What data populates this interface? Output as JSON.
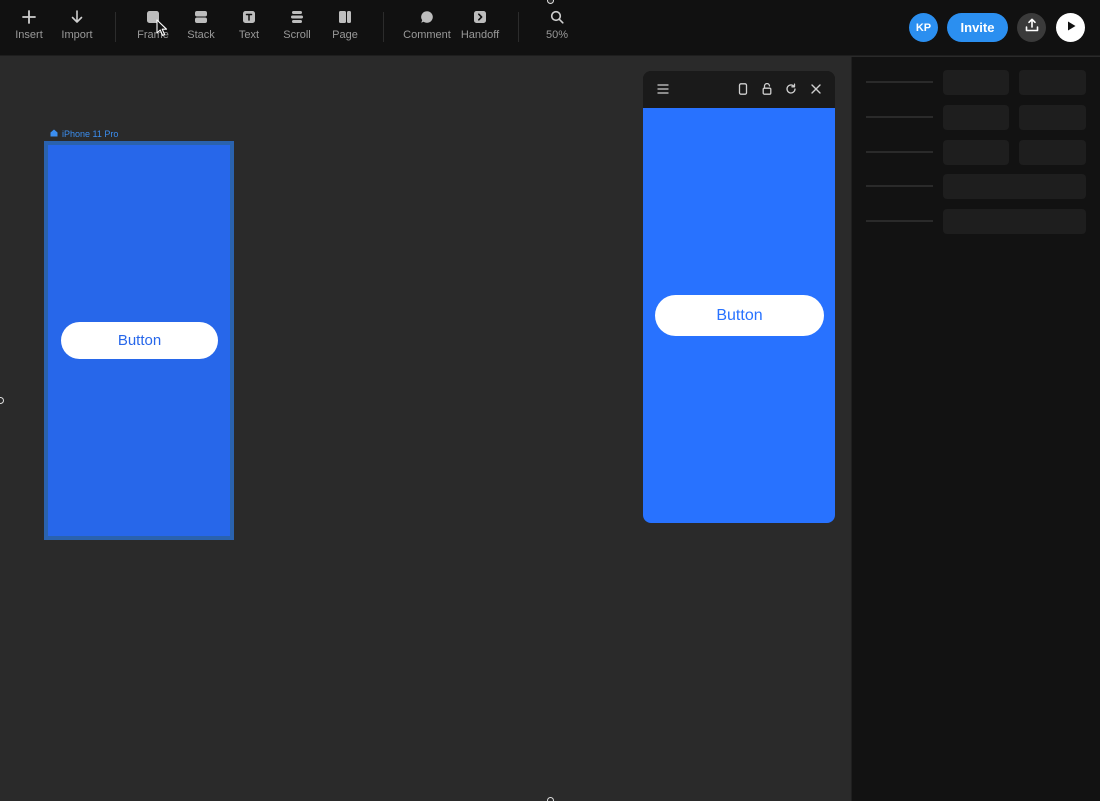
{
  "toolbar": {
    "items": [
      {
        "label": "Insert",
        "icon": "plus-icon"
      },
      {
        "label": "Import",
        "icon": "arrow-down-icon"
      },
      {
        "label": "Frame",
        "icon": "frame-icon"
      },
      {
        "label": "Stack",
        "icon": "stack-icon"
      },
      {
        "label": "Text",
        "icon": "text-icon"
      },
      {
        "label": "Scroll",
        "icon": "scroll-icon"
      },
      {
        "label": "Page",
        "icon": "page-icon"
      },
      {
        "label": "Comment",
        "icon": "comment-icon"
      },
      {
        "label": "Handoff",
        "icon": "handoff-icon"
      },
      {
        "label": "50%",
        "icon": "zoom-icon"
      }
    ],
    "avatar_initials": "KP",
    "invite_label": "Invite"
  },
  "canvas": {
    "frame_label": "iPhone 11 Pro",
    "frame_button_label": "Button"
  },
  "preview": {
    "button_label": "Button"
  },
  "colors": {
    "accent": "#2b8ff0",
    "frame_fill": "#2767ea",
    "preview_fill": "#2872ff",
    "canvas_bg": "#2a2a2a",
    "toolbar_bg": "#111111"
  }
}
